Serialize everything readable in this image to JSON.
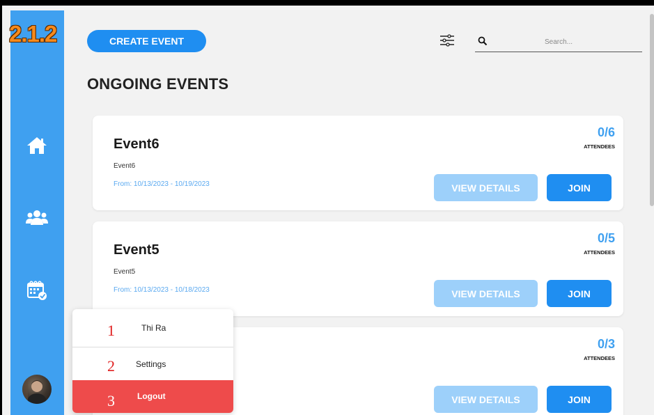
{
  "version_tag": "2.1.2",
  "header": {
    "create_label": "CREATE EVENT",
    "search_placeholder": "Search..."
  },
  "page_title": "ONGOING EVENTS",
  "sidebar": {
    "items": [
      {
        "icon": "home-icon"
      },
      {
        "icon": "users-icon"
      },
      {
        "icon": "calendar-check-icon"
      }
    ]
  },
  "events": [
    {
      "name": "Event6",
      "description": "Event6",
      "date": "From: 10/13/2023 - 10/19/2023",
      "count": "0/6",
      "attendees_label": "ATTENDEES",
      "details_label": "VIEW DETAILS",
      "join_label": "JOIN"
    },
    {
      "name": "Event5",
      "description": "Event5",
      "date": "From: 10/13/2023 - 10/18/2023",
      "count": "0/5",
      "attendees_label": "ATTENDEES",
      "details_label": "VIEW DETAILS",
      "join_label": "JOIN"
    },
    {
      "name": "",
      "description": "",
      "date": "",
      "count": "0/3",
      "attendees_label": "ATTENDEES",
      "details_label": "VIEW DETAILS",
      "join_label": "JOIN"
    }
  ],
  "user_menu": {
    "items": [
      {
        "num": "1",
        "label": "Thi Ra"
      },
      {
        "num": "2",
        "label": "Settings"
      },
      {
        "num": "3",
        "label": "Logout"
      }
    ]
  },
  "colors": {
    "sidebar": "#3fa0f0",
    "primary": "#1f8ef1",
    "secondary": "#9dd0fa",
    "logout": "#ee4b4b",
    "version_tag": "#f58a1c"
  }
}
